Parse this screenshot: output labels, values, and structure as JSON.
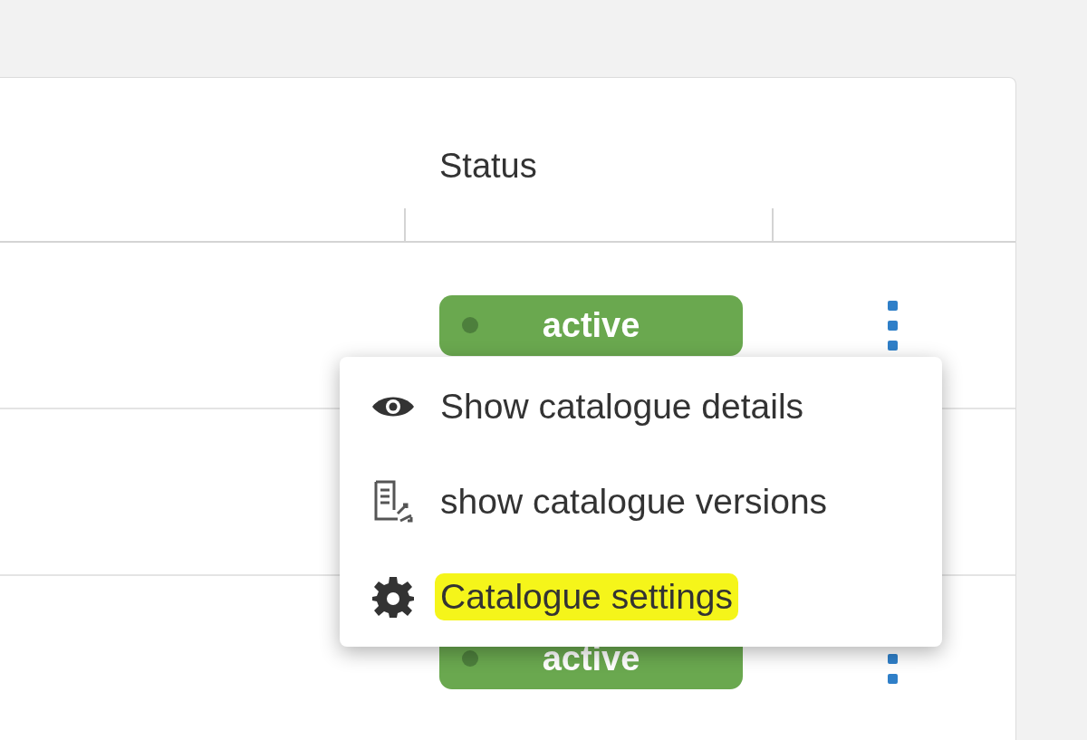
{
  "table": {
    "status_header": "Status",
    "rows": [
      {
        "status": "active",
        "menu": {
          "items": [
            {
              "kind": "view",
              "label": "Show catalogue details",
              "highlighted": false
            },
            {
              "kind": "versions",
              "label": "show catalogue versions",
              "highlighted": false
            },
            {
              "kind": "settings",
              "label": "Catalogue settings",
              "highlighted": true
            }
          ]
        }
      },
      {},
      {
        "status": "active"
      }
    ]
  }
}
